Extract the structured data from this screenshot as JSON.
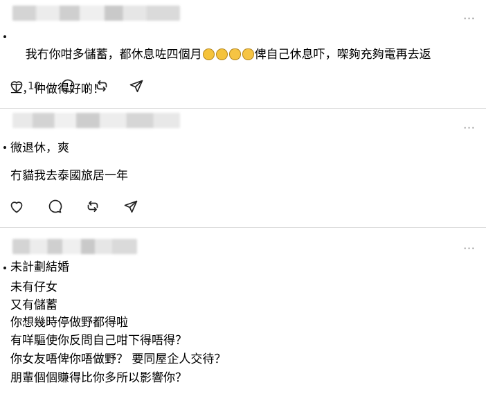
{
  "posts": [
    {
      "more_label": "···",
      "line1": "我冇你咁多儲蓄，都休息咗四個月",
      "emoji_tail": "讓自己休息吓，攞夠充夠電再去返",
      "line2": "工，仲做得好啲！",
      "likes": "10"
    },
    {
      "more_label": "···",
      "line1": "微退休，爽",
      "line2": "冇貓我去泰國旅居一年"
    },
    {
      "more_label": "···",
      "lines": [
        "未計劃結婚",
        "未有仔女",
        "又有儲蓄",
        "你想幾時停做野都得啦",
        "有咩驅使你反問自己咁下得唔得？",
        "你女友唔俾你唔做野？ 要同屋企人交待？",
        "朋輩個個賺得比你多所以影響你？"
      ]
    }
  ],
  "icons": [
    "heart-icon",
    "comment-icon",
    "repost-icon",
    "share-icon",
    "more-icon"
  ]
}
